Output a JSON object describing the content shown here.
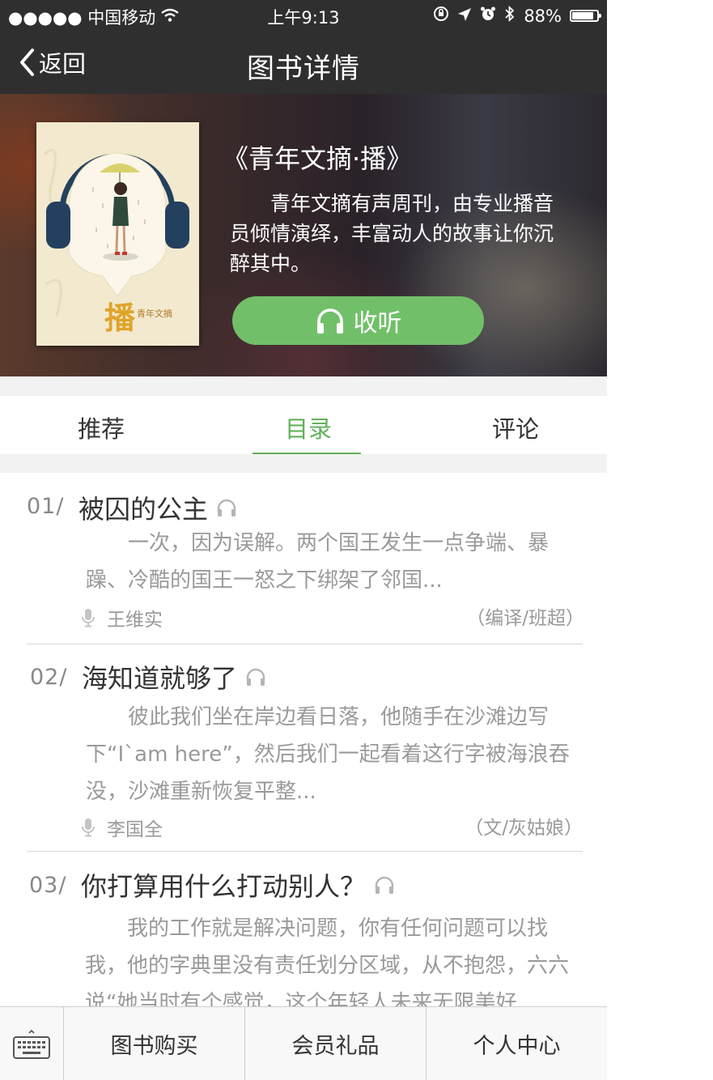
{
  "status_bar": {
    "carrier": "●●●●● 中国移动",
    "time": "上午9:13",
    "battery_text": "88%",
    "battery_level": 0.88
  },
  "nav": {
    "back_label": "返回",
    "title": "图书详情"
  },
  "book": {
    "title": "《青年文摘·播》",
    "description": "青年文摘有声周刊，由专业播音员倾情演绎，丰富动人的故事让你沉醉其中。",
    "listen_label": "收听",
    "cover_text_large": "播",
    "cover_text_small": "青年文摘"
  },
  "tabs": [
    {
      "label": "推荐",
      "active": false
    },
    {
      "label": "目录",
      "active": true
    },
    {
      "label": "评论",
      "active": false
    }
  ],
  "items": [
    {
      "number": "01/",
      "title": "被囚的公主",
      "excerpt": "一次，因为误解。两个国王发生一点争端、暴躁、冷酷的国王一怒之下绑架了邻国...",
      "narrator": "王维实",
      "credit": "（编译/班超）"
    },
    {
      "number": "02/",
      "title": "海知道就够了",
      "excerpt": "彼此我们坐在岸边看日落，他随手在沙滩边写下“I`am here”，然后我们一起看着这行字被海浪吞没，沙滩重新恢复平整...",
      "narrator": "李国全",
      "credit": "（文/灰姑娘）"
    },
    {
      "number": "03/",
      "title": "你打算用什么打动别人？",
      "excerpt": "我的工作就是解决问题，你有任何问题可以找我，他的字典里没有责任划分区域，从不抱怨，六六说“她当时有个感觉，这个年轻人未来无限美好..."
    }
  ],
  "bottom_bar": {
    "buy_label": "图书购买",
    "gift_label": "会员礼品",
    "profile_label": "个人中心"
  },
  "colors": {
    "accent": "#62b15a",
    "listen_button": "#72bf6a",
    "navbar": "#2f2f2f"
  }
}
